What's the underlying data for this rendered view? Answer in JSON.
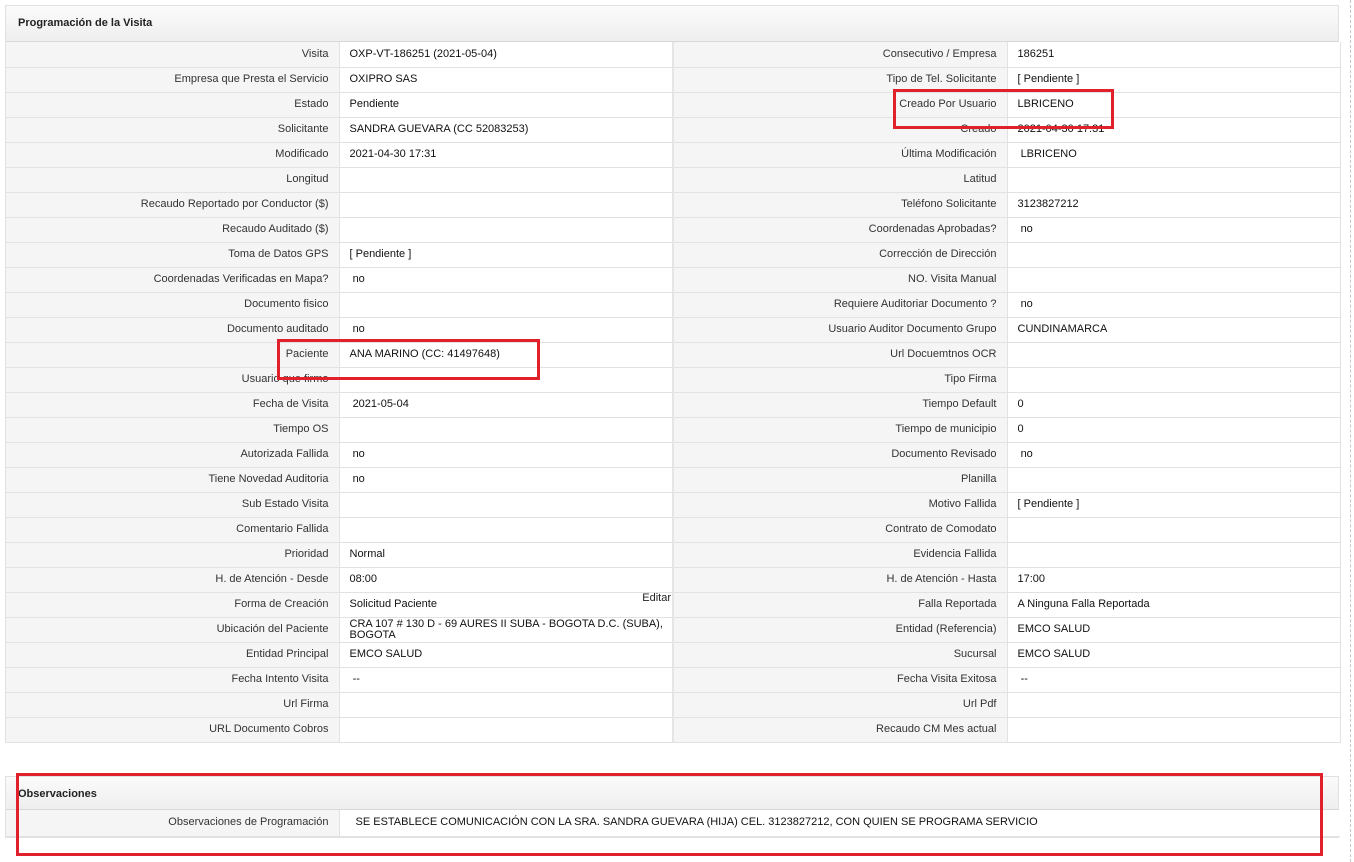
{
  "main": {
    "title": "Programación de la Visita",
    "edit_label": "Editar",
    "rows": [
      {
        "l1": "Visita",
        "v1": "OXP-VT-186251 (2021-05-04)",
        "l2": "Consecutivo / Empresa",
        "v2": "186251"
      },
      {
        "l1": "Empresa que Presta el Servicio",
        "v1": "OXIPRO SAS",
        "l2": "Tipo de Tel. Solicitante",
        "v2": "[ Pendiente ]"
      },
      {
        "l1": "Estado",
        "v1": "Pendiente",
        "l2": "Creado Por Usuario",
        "v2": "LBRICENO"
      },
      {
        "l1": "Solicitante",
        "v1": "SANDRA GUEVARA (CC 52083253)",
        "l2": "Creado",
        "v2": "2021-04-30 17:31"
      },
      {
        "l1": "Modificado",
        "v1": "2021-04-30 17:31",
        "l2": "Última Modificación",
        "v2": " LBRICENO"
      },
      {
        "l1": "Longitud",
        "v1": "",
        "l2": "Latitud",
        "v2": ""
      },
      {
        "l1": "Recaudo Reportado por Conductor ($)",
        "v1": "",
        "l2": "Teléfono Solicitante",
        "v2": "3123827212"
      },
      {
        "l1": "Recaudo Auditado ($)",
        "v1": "",
        "l2": "Coordenadas Aprobadas?",
        "v2": " no"
      },
      {
        "l1": "Toma de Datos GPS",
        "v1": "[ Pendiente ]",
        "l2": "Corrección de Dirección",
        "v2": ""
      },
      {
        "l1": "Coordenadas Verificadas en Mapa?",
        "v1": " no",
        "l2": "NO. Visita Manual",
        "v2": ""
      },
      {
        "l1": "Documento fisico",
        "v1": "",
        "l2": "Requiere Auditoriar Documento ?",
        "v2": " no"
      },
      {
        "l1": "Documento auditado",
        "v1": " no",
        "l2": "Usuario Auditor Documento Grupo",
        "v2": "CUNDINAMARCA"
      },
      {
        "l1": "Paciente",
        "v1": "ANA MARINO (CC: 41497648)",
        "l2": "Url Docuemtnos OCR",
        "v2": ""
      },
      {
        "l1": "Usuario que firmo",
        "v1": "",
        "l2": "Tipo Firma",
        "v2": ""
      },
      {
        "l1": "Fecha de Visita",
        "v1": " 2021-05-04",
        "l2": "Tiempo Default",
        "v2": "0"
      },
      {
        "l1": "Tiempo OS",
        "v1": "",
        "l2": "Tiempo de municipio",
        "v2": "0"
      },
      {
        "l1": "Autorizada Fallida",
        "v1": " no",
        "l2": "Documento Revisado",
        "v2": " no"
      },
      {
        "l1": "Tiene Novedad Auditoria",
        "v1": " no",
        "l2": "Planilla",
        "v2": ""
      },
      {
        "l1": "Sub Estado Visita",
        "v1": "",
        "l2": "Motivo Fallida",
        "v2": "[ Pendiente ]"
      },
      {
        "l1": "Comentario Fallida",
        "v1": "",
        "l2": "Contrato de Comodato",
        "v2": ""
      },
      {
        "l1": "Prioridad",
        "v1": "Normal",
        "l2": "Evidencia Fallida",
        "v2": ""
      },
      {
        "l1": "H. de Atención - Desde",
        "v1": "08:00",
        "l2": "H. de Atención - Hasta",
        "v2": "17:00"
      },
      {
        "l1": "Forma de Creación",
        "v1": "Solicitud Paciente",
        "l2": "Falla Reportada",
        "v2": "A Ninguna Falla Reportada"
      },
      {
        "l1": "Ubicación del Paciente",
        "v1": "CRA 107 # 130 D - 69 AURES II SUBA - BOGOTA D.C. (SUBA), BOGOTA",
        "l2": "Entidad (Referencia)",
        "v2": "EMCO SALUD"
      },
      {
        "l1": "Entidad Principal",
        "v1": "EMCO SALUD",
        "l2": "Sucursal",
        "v2": "EMCO SALUD"
      },
      {
        "l1": "Fecha Intento Visita",
        "v1": " --",
        "l2": "Fecha Visita Exitosa",
        "v2": " --"
      },
      {
        "l1": "Url Firma",
        "v1": "",
        "l2": "Url Pdf",
        "v2": ""
      },
      {
        "l1": "URL Documento Cobros",
        "v1": "",
        "l2": "Recaudo CM Mes actual",
        "v2": ""
      }
    ]
  },
  "observations": {
    "title": "Observaciones",
    "label": "Observaciones de Programación",
    "value": "SE ESTABLECE COMUNICACIÓN CON LA SRA. SANDRA GUEVARA (HIJA) CEL. 3123827212, CON QUIEN SE PROGRAMA SERVICIO"
  },
  "colors": {
    "highlight": "#e0202a",
    "label_bg": "#f5f5f5",
    "border": "#e2e2e2"
  }
}
